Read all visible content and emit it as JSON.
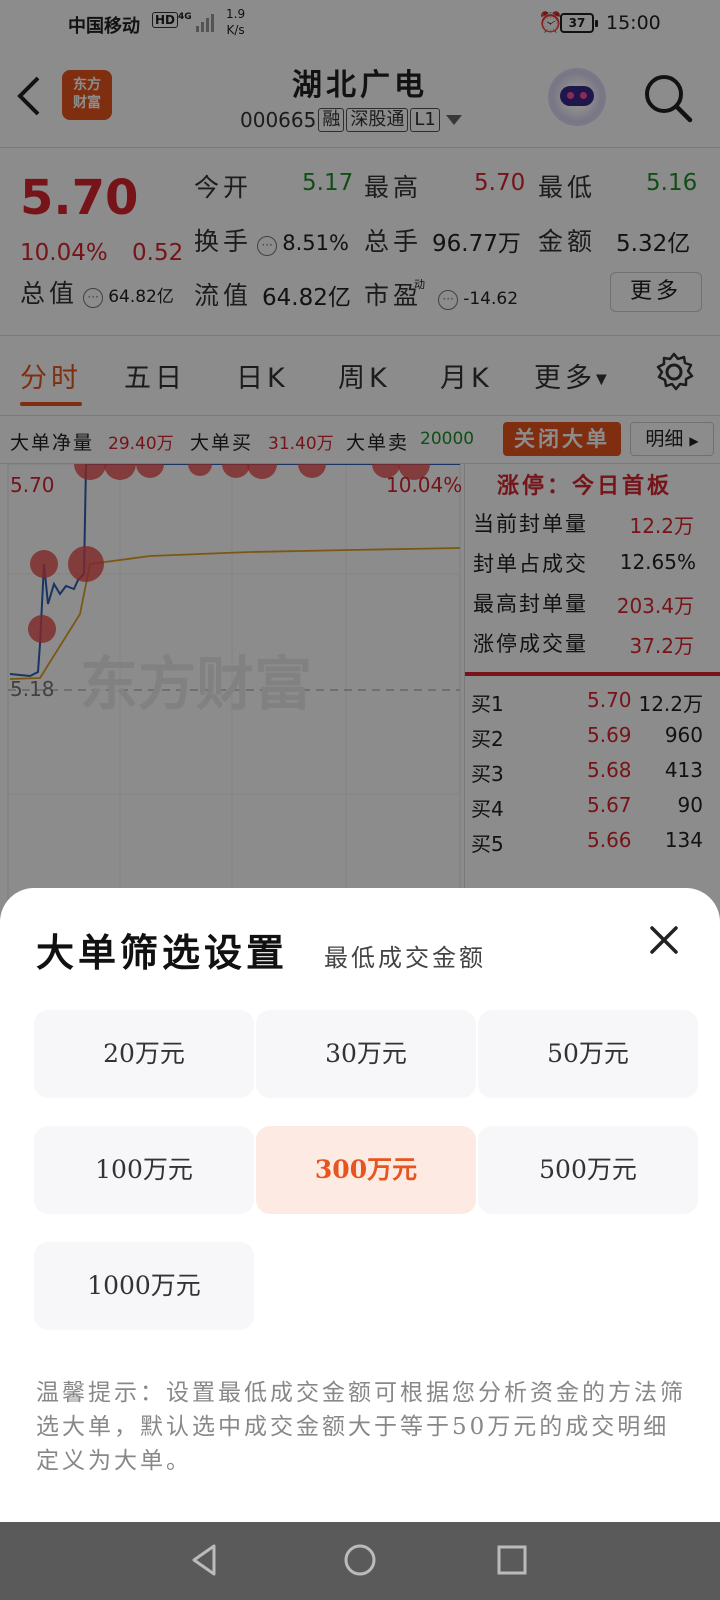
{
  "status_bar": {
    "carrier": "中国移动",
    "hd": "HD",
    "network": "4G",
    "speed_value": "1.9",
    "speed_unit": "K/s",
    "battery": "37",
    "time": "15:00"
  },
  "header": {
    "logo_line1": "东方",
    "logo_line2": "财富",
    "stock_name": "湖北广电",
    "stock_code": "000665",
    "tags": [
      "融",
      "深股通",
      "L1"
    ]
  },
  "quote": {
    "price": "5.70",
    "change_pct": "10.04%",
    "change": "0.52",
    "open_label": "今开",
    "open": "5.17",
    "high_label": "最高",
    "high": "5.70",
    "low_label": "最低",
    "low": "5.16",
    "turnover_label": "换手",
    "turnover": "8.51%",
    "volume_label": "总手",
    "volume": "96.77万",
    "amount_label": "金额",
    "amount": "5.32亿",
    "mktcap_label": "总值",
    "mktcap": "64.82亿",
    "float_label": "流值",
    "float": "64.82亿",
    "pe_label": "市盈",
    "pe_sup": "动",
    "pe": "-14.62",
    "more": "更多"
  },
  "tabs": [
    "分时",
    "五日",
    "日K",
    "周K",
    "月K",
    "更多"
  ],
  "big_order": {
    "net_label": "大单净量",
    "net": "29.40万",
    "buy_label": "大单买",
    "buy": "31.40万",
    "sell_label": "大单卖",
    "sell": "20000",
    "close_btn": "关闭大单",
    "detail_btn": "明细"
  },
  "chart": {
    "top_price": "5.70",
    "top_pct": "10.04%",
    "base_price": "5.18",
    "watermark": "东方财富"
  },
  "side_panel": {
    "title": "涨停：今日首板",
    "rows": [
      {
        "label": "当前封单量",
        "value": "12.2万"
      },
      {
        "label": "封单占成交",
        "value": "12.65%"
      },
      {
        "label": "最高封单量",
        "value": "203.4万"
      },
      {
        "label": "涨停成交量",
        "value": "37.2万"
      }
    ],
    "orderbook": [
      {
        "label": "买1",
        "price": "5.70",
        "vol": "12.2万"
      },
      {
        "label": "买2",
        "price": "5.69",
        "vol": "960"
      },
      {
        "label": "买3",
        "price": "5.68",
        "vol": "413"
      },
      {
        "label": "买4",
        "price": "5.67",
        "vol": "90"
      },
      {
        "label": "买5",
        "price": "5.66",
        "vol": "134"
      }
    ]
  },
  "sheet": {
    "title": "大单筛选设置",
    "subtitle": "最低成交金额",
    "options": [
      "20万元",
      "30万元",
      "50万元",
      "100万元",
      "300万元",
      "500万元",
      "1000万元"
    ],
    "selected": "300万元",
    "tip": "温馨提示：设置最低成交金额可根据您分析资金的方法筛选大单，默认选中成交金额大于等于50万元的成交明细定义为大单。"
  },
  "colors": {
    "accent": "#e8541e",
    "up": "#d7262f",
    "down": "#1f8f2b"
  }
}
